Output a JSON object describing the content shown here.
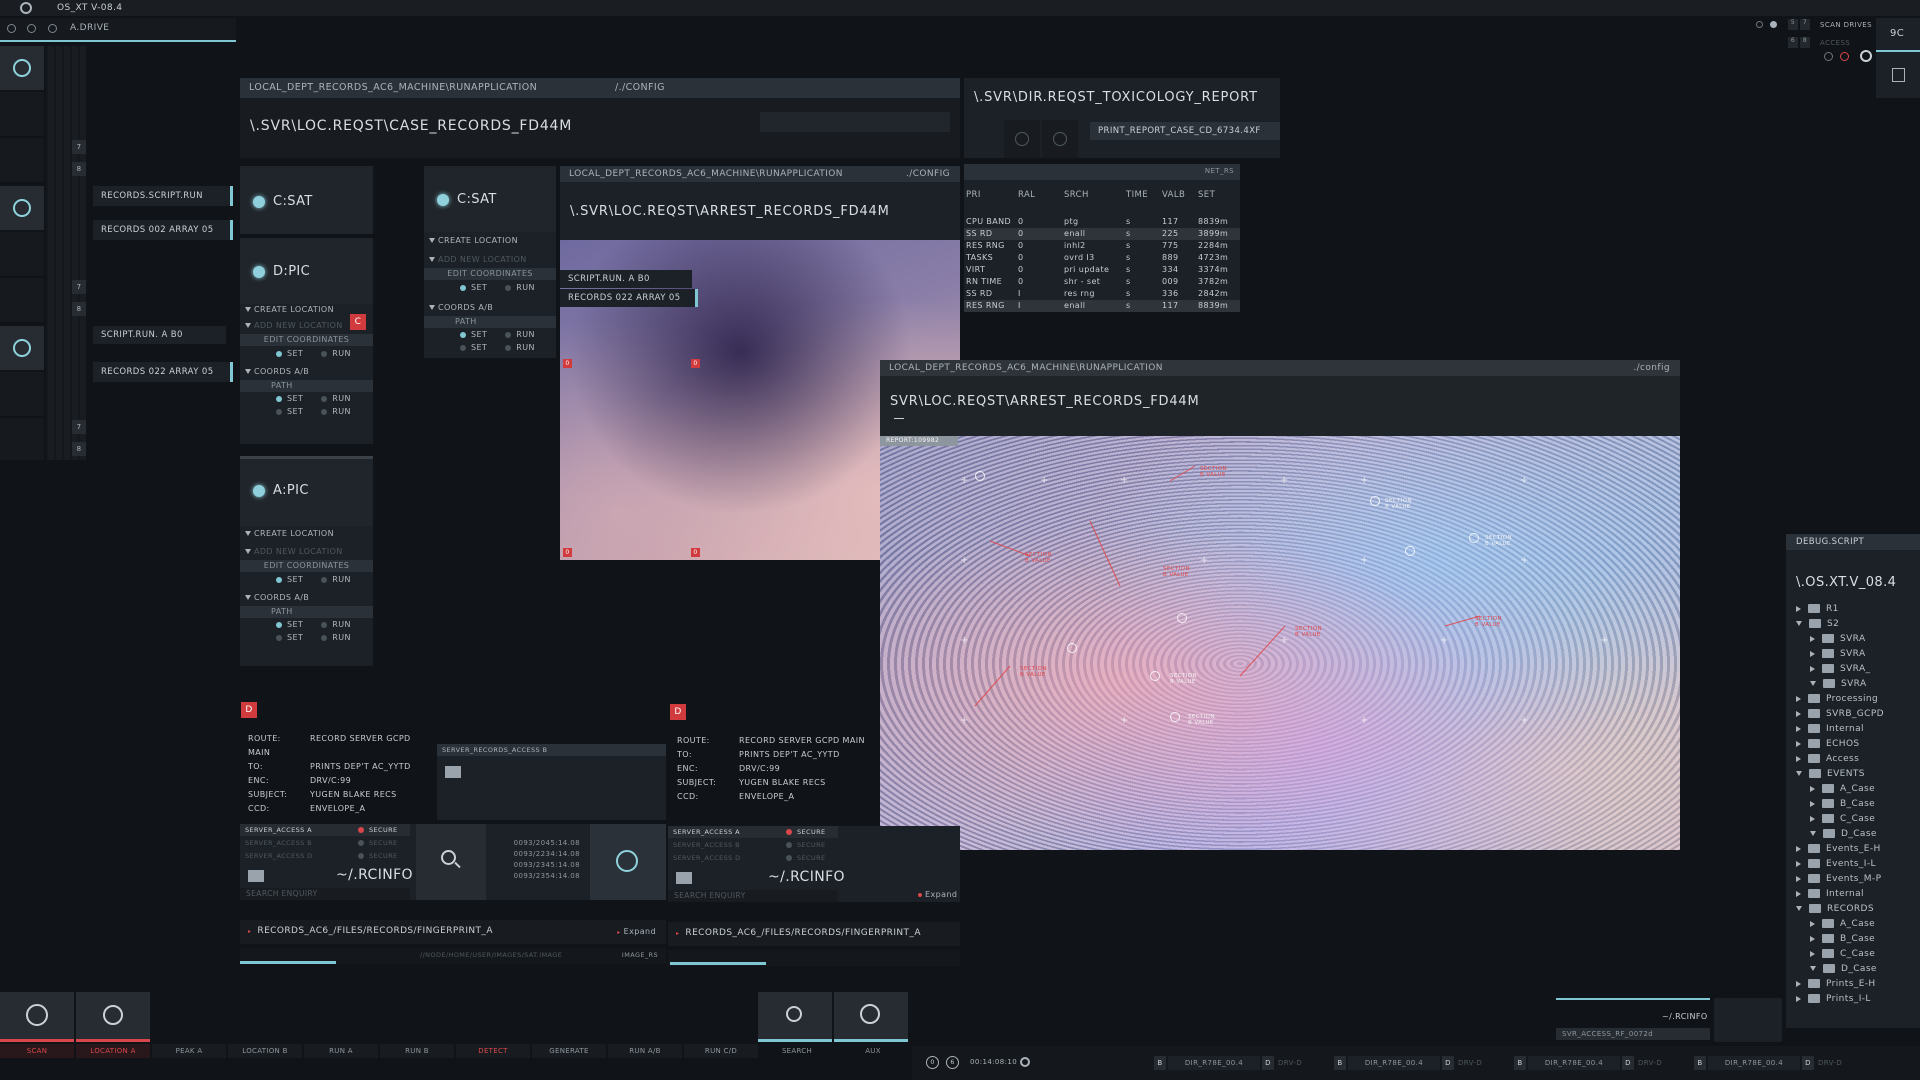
{
  "topbar": {
    "app_title": "OS_XT V-08.4",
    "drive": "A.DRIVE",
    "scan_drives": "SCAN DRIVES",
    "access": "ACCESS",
    "temp": "9C"
  },
  "left_sidebar": {
    "n7a": "7",
    "n8a": "8",
    "n7b": "7",
    "n8b": "8",
    "n7c": "7",
    "n8c": "8",
    "script_run": "RECORDS.SCRIPT.RUN",
    "array05": "RECORDS 002 ARRAY 05",
    "script_run2": "SCRIPT.RUN. A B0",
    "array05b": "RECORDS 022 ARRAY 05"
  },
  "case_window": {
    "header": "LOCAL_DEPT_RECORDS_AC6_MACHINE\\RUNAPPLICATION",
    "header_right": "/./CONFIG",
    "title": "\\.SVR\\LOC.REQST\\CASE_RECORDS_FD44M"
  },
  "menus": {
    "create_location": "CREATE LOCATION",
    "add_new_location": "ADD NEW LOCATION",
    "edit_coordinates": "EDIT COORDINATES",
    "set": "SET",
    "run": "RUN",
    "coords": "COORDS A/B",
    "path": "PATH"
  },
  "sats": {
    "c_sat": "C:SAT",
    "d_pic": "D:PIC",
    "a_pic": "A:PIC",
    "c_sat2": "C:SAT",
    "c_badge": "C"
  },
  "arrest_small": {
    "header": "LOCAL_DEPT_RECORDS_AC6_MACHINE\\RUNAPPLICATION",
    "header_right": "./CONFIG",
    "title": "\\.SVR\\LOC.REQST\\ARREST_RECORDS_FD44M",
    "script": "SCRIPT.RUN. A B0",
    "array": "RECORDS 022 ARRAY 05",
    "marker": "0"
  },
  "tox": {
    "title": "\\.SVR\\DIR.REQST_TOXICOLOGY_REPORT",
    "print": "PRINT_REPORT_CASE_CD_6734.4XF"
  },
  "table": {
    "net": "NET_RS",
    "headers": [
      "PRI",
      "RAL",
      "SRCH",
      "TIME",
      "VALB",
      "SET"
    ],
    "rows": [
      [
        "CPU BAND",
        "0",
        "ptg",
        "s",
        "117",
        "8839m"
      ],
      [
        "SS RD",
        "0",
        "enall",
        "s",
        "225",
        "3899m"
      ],
      [
        "RES RNG",
        "0",
        "inhl2",
        "s",
        "775",
        "2284m"
      ],
      [
        "TASKS",
        "0",
        "ovrd  I3",
        "s",
        "889",
        "4723m"
      ],
      [
        "VIRT",
        "0",
        "pri update",
        "s",
        "334",
        "3374m"
      ],
      [
        "RN TIME",
        "0",
        "shr - set",
        "s",
        "009",
        "3782m"
      ],
      [
        "SS RD",
        "I",
        "res rng",
        "s",
        "336",
        "2842m"
      ],
      [
        "RES RNG",
        "I",
        "enall",
        "s",
        "117",
        "8839m"
      ]
    ]
  },
  "big_window": {
    "header": "LOCAL_DEPT_RECORDS_AC6_MACHINE\\RUNAPPLICATION",
    "header_right": "./config",
    "title": "SVR\\LOC.REQST\\ARREST_RECORDS_FD44M",
    "report": "REPORT:109982",
    "section": "SECTION",
    "value": "B VALUE",
    "corner": "D"
  },
  "route_left": {
    "d": "D",
    "route_l": "ROUTE:",
    "route": "RECORD SERVER GCPD MAIN",
    "to_l": "TO:",
    "to": "PRINTS DEP'T AC_YYTD",
    "enc_l": "ENC:",
    "enc": "DRV/C:99",
    "subject_l": "SUBJECT:",
    "subject": "YUGEN BLAKE RECS",
    "ccd_l": "CCD:",
    "ccd": "ENVELOPE_A",
    "server_records": "SERVER_RECORDS_ACCESS B",
    "sa_a": "SERVER_ACCESS A",
    "sa_b": "SERVER_ACCESS B",
    "sa_d": "SERVER_ACCESS D",
    "secure": "SECURE",
    "rcinfo": "~/.RCINFO",
    "search": "SEARCH ENQUIRY",
    "times": [
      "0093/2045:14.08",
      "0093/2234:14.08",
      "0093/2345:14.08",
      "0093/2354:14.08"
    ],
    "path": "RECORDS_AC6_/FILES/RECORDS/FINGERPRINT_A",
    "expand": "Expand",
    "node": "//NODE/HOME/USER/IMAGES/SAT.IMAGE",
    "image_rs": "IMAGE_RS"
  },
  "route_right": {
    "d": "D",
    "route_l": "ROUTE:",
    "route": "RECORD SERVER GCPD MAIN",
    "to_l": "TO:",
    "to": "PRINTS DEP'T AC_YYTD",
    "enc_l": "ENC:",
    "enc": "DRV/C:99",
    "subject_l": "SUBJECT:",
    "subject": "YUGEN BLAKE RECS",
    "ccd_l": "CCD:",
    "ccd": "ENVELOPE_A",
    "sa_a": "SERVER_ACCESS A",
    "sa_b": "SERVER_ACCESS B",
    "sa_d": "SERVER_ACCESS D",
    "secure": "SECURE",
    "rcinfo": "~/.RCINFO",
    "search": "SEARCH ENQUIRY",
    "expand": "Expand",
    "path": "RECORDS_AC6_/FILES/RECORDS/FINGERPRINT_A"
  },
  "debug": {
    "header": "DEBUG.SCRIPT",
    "title": "\\.OS.XT.V_08.4",
    "tree": [
      {
        "label": "R1",
        "level": 0,
        "open": false
      },
      {
        "label": "S2",
        "level": 0,
        "open": true
      },
      {
        "label": "SVRA",
        "level": 1,
        "open": false
      },
      {
        "label": "SVRA",
        "level": 1,
        "open": false
      },
      {
        "label": "SVRA_",
        "level": 1,
        "open": false
      },
      {
        "label": "SVRA",
        "level": 1,
        "open": true
      },
      {
        "label": "Processing",
        "level": 0,
        "open": false
      },
      {
        "label": "SVRB_GCPD",
        "level": 0,
        "open": false
      },
      {
        "label": "Internal",
        "level": 0,
        "open": false
      },
      {
        "label": "ECHOS",
        "level": 0,
        "open": false
      },
      {
        "label": "Access",
        "level": 0,
        "open": false
      },
      {
        "label": "EVENTS",
        "level": 0,
        "open": true
      },
      {
        "label": "A_Case",
        "level": 1,
        "open": false
      },
      {
        "label": "B_Case",
        "level": 1,
        "open": false
      },
      {
        "label": "C_Case",
        "level": 1,
        "open": false
      },
      {
        "label": "D_Case",
        "level": 1,
        "open": true
      },
      {
        "label": "Events_E-H",
        "level": 0,
        "open": false
      },
      {
        "label": "Events_I-L",
        "level": 0,
        "open": false
      },
      {
        "label": "Events_M-P",
        "level": 0,
        "open": false
      },
      {
        "label": "Internal",
        "level": 0,
        "open": false
      },
      {
        "label": "RECORDS",
        "level": 0,
        "open": true
      },
      {
        "label": "A_Case",
        "level": 1,
        "open": false
      },
      {
        "label": "B_Case",
        "level": 1,
        "open": false
      },
      {
        "label": "C_Case",
        "level": 1,
        "open": false
      },
      {
        "label": "D_Case",
        "level": 1,
        "open": true
      },
      {
        "label": "Prints_E-H",
        "level": 0,
        "open": false
      },
      {
        "label": "Prints_I-L",
        "level": 0,
        "open": false
      }
    ]
  },
  "rcinfo_small": {
    "label": "~/.RCINFO",
    "access": "SVR_ACCESS_RF_0072d"
  },
  "bottom": {
    "items": [
      "SCAN",
      "LOCATION A",
      "PEAK A",
      "LOCATION B",
      "RUN A",
      "RUN B",
      "DETECT",
      "GENERATE",
      "RUN A/B",
      "RUN C/D",
      "SEARCH",
      "AUX"
    ],
    "time": "00:14:08:10",
    "c0": "0",
    "c6": "6",
    "drives": [
      {
        "b": "B",
        "name": "DIR_R78E_00.4",
        "d": "D",
        "drv": "DRV-D"
      },
      {
        "b": "B",
        "name": "DIR_R78E_00.4",
        "d": "D",
        "drv": "DRV-D"
      },
      {
        "b": "B",
        "name": "DIR_R78E_00.4",
        "d": "D",
        "drv": "DRV-D"
      },
      {
        "b": "B",
        "name": "DIR_R78E_00.4",
        "d": "D",
        "drv": "DRV-D"
      }
    ]
  },
  "colors": {
    "accent": "#8fd0dc",
    "alert": "#d13b3e",
    "bg": "#101317",
    "panel": "#1c2127"
  }
}
